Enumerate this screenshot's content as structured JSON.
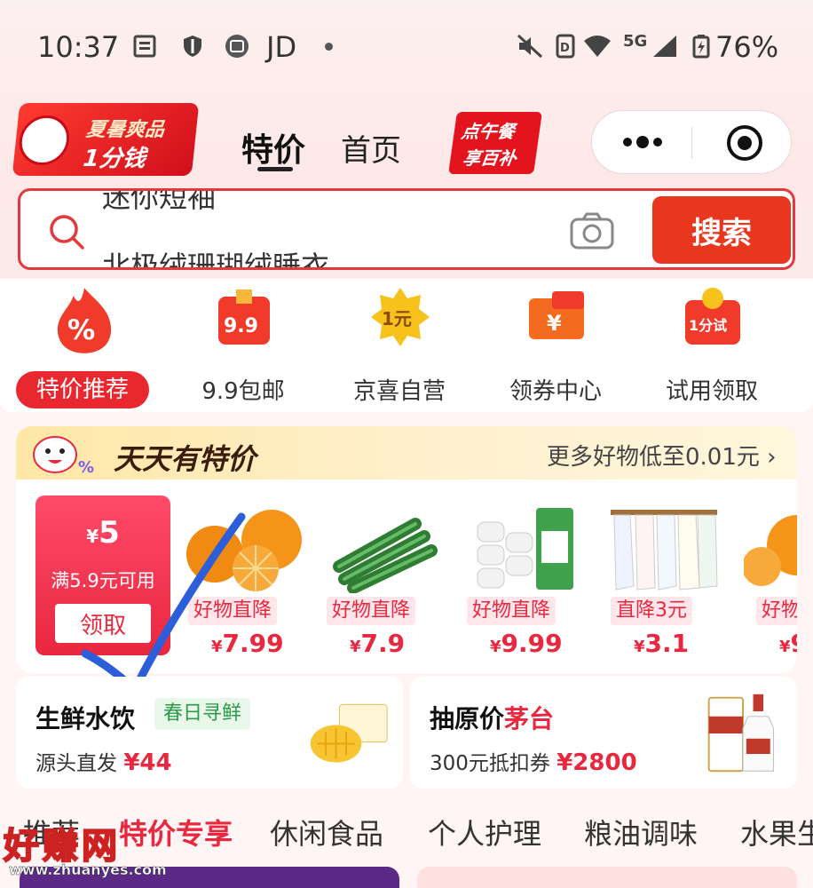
{
  "status_bar": {
    "time": "10:37",
    "app_label": "JD",
    "network": "5G",
    "battery": "76%"
  },
  "header": {
    "left_promo": {
      "line1": "夏暑爽品",
      "line2": "1分钱"
    },
    "tab_active": "特价",
    "tab_home": "首页",
    "right_promo": {
      "line1": "点午餐",
      "line2": "享百补"
    }
  },
  "search": {
    "placeholder_top": "迷你短袖",
    "placeholder_bottom": "北极绒珊瑚绒睡衣",
    "button": "搜索"
  },
  "categories": [
    {
      "label": "特价推荐",
      "icon": "percent-flame-icon",
      "active": true
    },
    {
      "label": "9.9包邮",
      "icon": "gift-box-icon",
      "active": false
    },
    {
      "label": "京喜自营",
      "icon": "one-yuan-badge-icon",
      "active": false
    },
    {
      "label": "领券中心",
      "icon": "coupon-icon",
      "active": false
    },
    {
      "label": "试用领取",
      "icon": "trial-bag-icon",
      "active": false
    }
  ],
  "deals": {
    "title": "天天有特价",
    "more": "更多好物低至0.01元 ›",
    "coupon": {
      "currency": "¥",
      "amount": "5",
      "condition": "满5.9元可用",
      "button": "领取"
    },
    "products": [
      {
        "tag": "好物直降",
        "currency": "¥",
        "price": "7.99",
        "image": "oranges"
      },
      {
        "tag": "好物直降",
        "currency": "¥",
        "price": "7.9",
        "image": "cucumbers"
      },
      {
        "tag": "好物直降",
        "currency": "¥",
        "price": "9.99",
        "image": "tissue-rolls"
      },
      {
        "tag": "直降3元",
        "currency": "¥",
        "price": "3.1",
        "image": "towels"
      },
      {
        "tag": "好物",
        "currency": "¥",
        "price": "9",
        "image": "oranges"
      }
    ]
  },
  "cards": {
    "fresh": {
      "title": "生鲜水饮",
      "badge": "春日寻鲜",
      "sub": "源头直发 ",
      "price": "¥44"
    },
    "maotai": {
      "title_a": "抽原价",
      "title_b": "茅台",
      "sub": "300元抵扣券 ",
      "price": "¥2800"
    }
  },
  "category_tabs": [
    "推荐",
    "特价专享",
    "休闲食品",
    "个人护理",
    "粮油调味",
    "水果生"
  ],
  "watermark": {
    "big": "好赚网",
    "small": "www.zhuanyes.com"
  },
  "colors": {
    "accent": "#e8283f",
    "search_border": "#e4393c",
    "search_button": "#e8371e"
  }
}
